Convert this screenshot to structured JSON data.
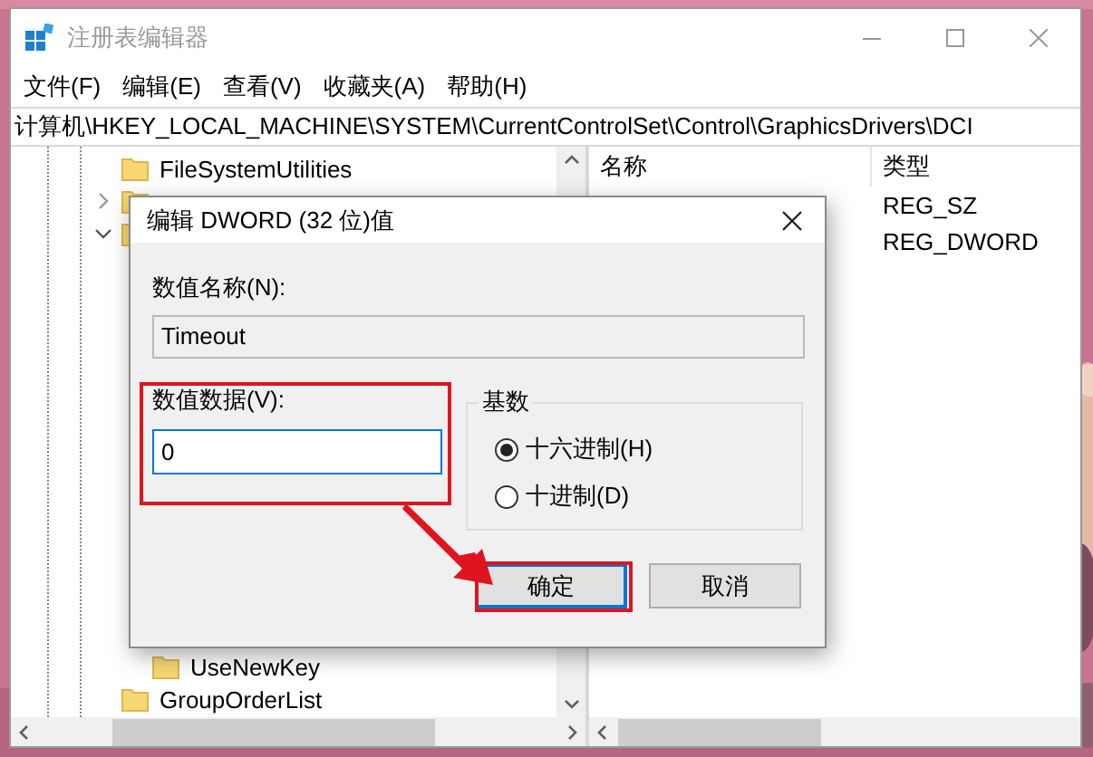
{
  "window": {
    "title": "注册表编辑器"
  },
  "menu": [
    "文件(F)",
    "编辑(E)",
    "查看(V)",
    "收藏夹(A)",
    "帮助(H)"
  ],
  "address": "计算机\\HKEY_LOCAL_MACHINE\\SYSTEM\\CurrentControlSet\\Control\\GraphicsDrivers\\DCI",
  "tree": [
    {
      "label": "FileSystemUtilities"
    },
    {
      "expanded": false
    },
    {
      "expanded": true,
      "children": [
        {
          "label": "UseNewKey"
        }
      ]
    },
    {
      "label": "GroupOrderList"
    }
  ],
  "list": {
    "columns": [
      "名称",
      "类型"
    ],
    "rows": [
      {
        "type": "REG_SZ"
      },
      {
        "type": "REG_DWORD"
      }
    ]
  },
  "dialog": {
    "title": "编辑 DWORD (32 位)值",
    "name_label": "数值名称(N):",
    "name_value": "Timeout",
    "data_label": "数值数据(V):",
    "data_value": "0",
    "base_label": "基数",
    "radios": [
      {
        "label": "十六进制(H)",
        "selected": true
      },
      {
        "label": "十进制(D)",
        "selected": false
      }
    ],
    "buttons": [
      {
        "label": "确定",
        "kind": "default"
      },
      {
        "label": "取消",
        "kind": "normal"
      }
    ]
  }
}
